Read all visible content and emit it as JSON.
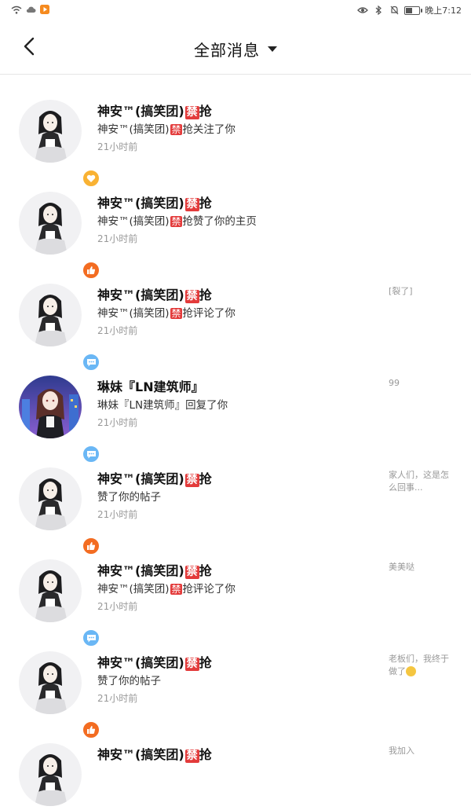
{
  "colors": {
    "like_badge": "#f36c21",
    "follow_badge": "#f9b233",
    "comment_badge": "#6ab7f5",
    "ban_tag": "#e33b3b"
  },
  "status_bar": {
    "time": "晚上7:12",
    "battery_level": 0.5
  },
  "header": {
    "title": "全部消息"
  },
  "messages": [
    {
      "name": "神安™(搞笑团)",
      "tag": "禁",
      "name_suffix": "抢",
      "action_prefix": "神安™(搞笑团)",
      "action_tag": "禁",
      "action_text": "抢关注了你",
      "time": "21小时前",
      "ref": "",
      "badge": "heart-icon",
      "avatar": "girl-bw"
    },
    {
      "name": "神安™(搞笑团)",
      "tag": "禁",
      "name_suffix": "抢",
      "action_prefix": "神安™(搞笑团)",
      "action_tag": "禁",
      "action_text": "抢赞了你的主页",
      "time": "21小时前",
      "ref": "",
      "badge": "thumbs-up-icon",
      "avatar": "girl-bw"
    },
    {
      "name": "神安™(搞笑团)",
      "tag": "禁",
      "name_suffix": "抢",
      "action_prefix": "神安™(搞笑团)",
      "action_tag": "禁",
      "action_text": "抢评论了你",
      "time": "21小时前",
      "ref": "[裂了]",
      "badge": "comment-icon",
      "avatar": "girl-bw"
    },
    {
      "name": "琳妹『LN建筑师』",
      "tag": "",
      "name_suffix": "",
      "action_prefix": "琳妹『LN建筑师』",
      "action_tag": "",
      "action_text": "回复了你",
      "time": "21小时前",
      "ref": "99",
      "badge": "comment-icon",
      "avatar": "girl-color"
    },
    {
      "name": "神安™(搞笑团)",
      "tag": "禁",
      "name_suffix": "抢",
      "action_prefix": "",
      "action_tag": "",
      "action_text": "赞了你的帖子",
      "time": "21小时前",
      "ref": "家人们，这是怎么回事...",
      "badge": "thumbs-up-icon",
      "avatar": "girl-bw"
    },
    {
      "name": "神安™(搞笑团)",
      "tag": "禁",
      "name_suffix": "抢",
      "action_prefix": "神安™(搞笑团)",
      "action_tag": "禁",
      "action_text": "抢评论了你",
      "time": "21小时前",
      "ref": "美美哒",
      "badge": "comment-icon",
      "avatar": "girl-bw"
    },
    {
      "name": "神安™(搞笑团)",
      "tag": "禁",
      "name_suffix": "抢",
      "action_prefix": "",
      "action_tag": "",
      "action_text": "赞了你的帖子",
      "time": "21小时前",
      "ref": "老板们，我终于做了",
      "badge": "thumbs-up-icon",
      "avatar": "girl-bw"
    },
    {
      "name": "神安™(搞笑团)",
      "tag": "禁",
      "name_suffix": "抢",
      "action_prefix": "",
      "action_tag": "",
      "action_text": "",
      "time": "",
      "ref": "我加入",
      "badge": "",
      "avatar": "girl-bw"
    }
  ]
}
